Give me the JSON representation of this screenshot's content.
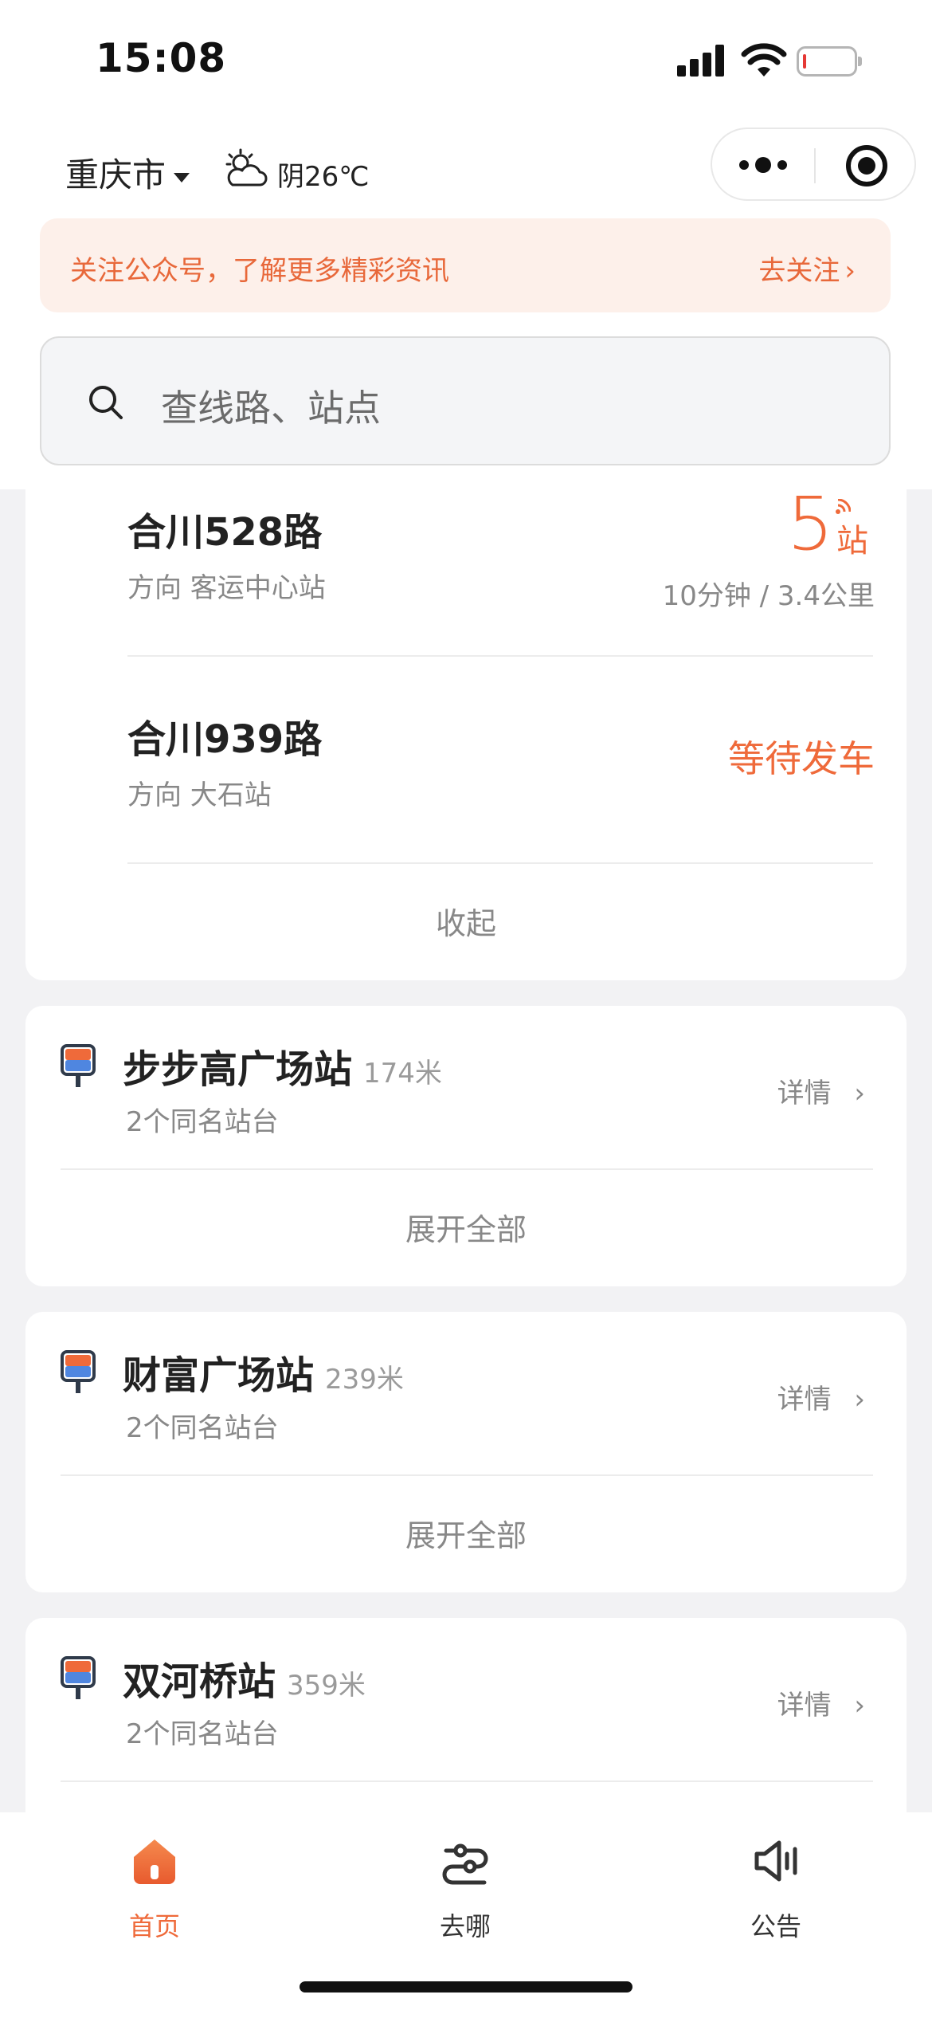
{
  "status_bar": {
    "time": "15:08"
  },
  "header": {
    "city": "重庆市",
    "weather_icon": "cloudy-sun-icon",
    "weather": "阴26℃"
  },
  "notice": {
    "text": "关注公众号，了解更多精彩资讯",
    "action": "去关注"
  },
  "search": {
    "placeholder": "查线路、站点"
  },
  "nearby_lines": [
    {
      "name": "合川528路",
      "direction": "方向 客运中心站",
      "stops_away": "5",
      "stops_unit": "站",
      "eta": "10分钟 / 3.4公里"
    },
    {
      "name": "合川939路",
      "direction": "方向 大石站",
      "status": "等待发车"
    }
  ],
  "collapse_label": "收起",
  "stations": [
    {
      "name": "步步高广场站",
      "distance": "174米",
      "sub": "2个同名站台",
      "detail": "详情",
      "expand": "展开全部"
    },
    {
      "name": "财富广场站",
      "distance": "239米",
      "sub": "2个同名站台",
      "detail": "详情",
      "expand": "展开全部"
    },
    {
      "name": "双河桥站",
      "distance": "359米",
      "sub": "2个同名站台",
      "detail": "详情"
    }
  ],
  "tabbar": {
    "items": [
      {
        "label": "首页",
        "icon": "home-icon",
        "active": true
      },
      {
        "label": "去哪",
        "icon": "route-icon",
        "active": false
      },
      {
        "label": "公告",
        "icon": "speaker-icon",
        "active": false
      }
    ]
  },
  "colors": {
    "accent": "#ef6a3a",
    "notice_bg": "#fdf0ea",
    "page_bg": "#f2f2f4"
  }
}
